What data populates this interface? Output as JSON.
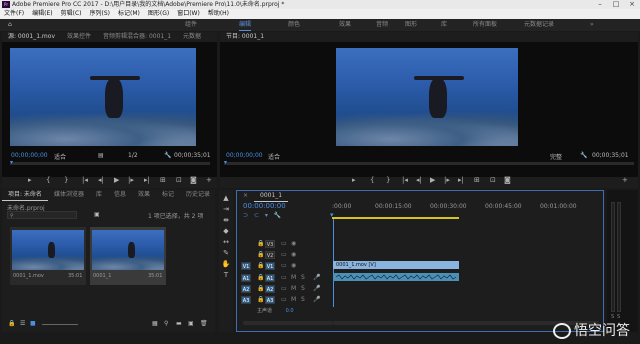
{
  "window": {
    "title": "Adobe Premiere Pro CC 2017 - D:\\用户目录\\我的文档\\Adobe\\Premiere Pro\\11.0\\未命名.prproj *",
    "app_icon_label": "Pr"
  },
  "menu": [
    "文件(F)",
    "编辑(E)",
    "剪辑(C)",
    "序列(S)",
    "标记(M)",
    "图形(G)",
    "窗口(W)",
    "帮助(H)"
  ],
  "workspaces": [
    "组件",
    "编辑",
    "颜色",
    "效果",
    "音频",
    "图形",
    "库",
    "所有面板",
    "元数据记录"
  ],
  "workspace_active": "编辑",
  "source_monitor": {
    "tabs": [
      "源: 0001_1.mov",
      "效果控件",
      "音频剪辑混合器: 0001_1",
      "元数据"
    ],
    "timecode": "00;00;00;00",
    "fit": "适合",
    "fraction": "1/2",
    "duration": "00;00;35;01"
  },
  "program_monitor": {
    "tab": "节目: 0001_1",
    "timecode": "00;00;00;00",
    "fit": "适合",
    "quality": "完整",
    "duration": "00;00;35;01"
  },
  "transport": [
    "▸",
    "{",
    "}",
    "|◂",
    "◂|",
    "▶",
    "|▸",
    "▸|",
    "⊞",
    "⊡",
    "◙"
  ],
  "project": {
    "tabs": [
      "项目: 未命名",
      "媒体浏览器",
      "库",
      "信息",
      "效果",
      "标记",
      "历史记录"
    ],
    "file": "未命名.prproj",
    "search_placeholder": "",
    "count": "1 项已选择，共 2 项",
    "items": [
      {
        "name": "0001_1.mov",
        "duration": "35:01"
      },
      {
        "name": "0001_1",
        "duration": "35:01"
      }
    ]
  },
  "timeline": {
    "tab": "0001_1",
    "timecode": "00:00:00:00",
    "ruler": [
      ":00:00",
      "00:00:15:00",
      "00:00:30:00",
      "00:00:45:00",
      "00:01:00:00"
    ],
    "video_tracks": [
      "V3",
      "V2",
      "V1"
    ],
    "audio_tracks": [
      "A1",
      "A2",
      "A3"
    ],
    "master": "主声道",
    "master_value": "0.0",
    "video_clip": "0001_1.mov [V]"
  },
  "watermark": "悟空问答",
  "colors": {
    "accent": "#4a90e2",
    "clip_video": "#8ab4e0",
    "clip_audio": "#4d8fb5"
  }
}
